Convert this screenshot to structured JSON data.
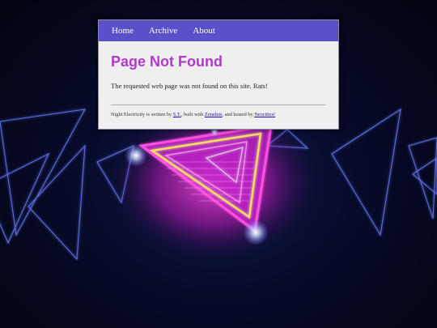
{
  "nav": {
    "items": [
      "Home",
      "Archive",
      "About"
    ]
  },
  "main": {
    "title": "Page Not Found",
    "message": "The requested web page was not found on this site. Rats!"
  },
  "footer": {
    "text_1": "Night Electricity is written by ",
    "author_link": "S.T.",
    "text_2": ", built with ",
    "builder_link": "Zonelets",
    "text_3": ", and hosted by ",
    "host_link": "Neocities!"
  },
  "colors": {
    "nav_bg": "#5a50c8",
    "title": "#b039c7",
    "card_bg": "#efefef",
    "link": "#1a0dab",
    "background": "#070b2a",
    "neon_pink": "#ff3fd8",
    "neon_yellow": "#ffe05a",
    "neon_blue": "#6c7dff"
  }
}
